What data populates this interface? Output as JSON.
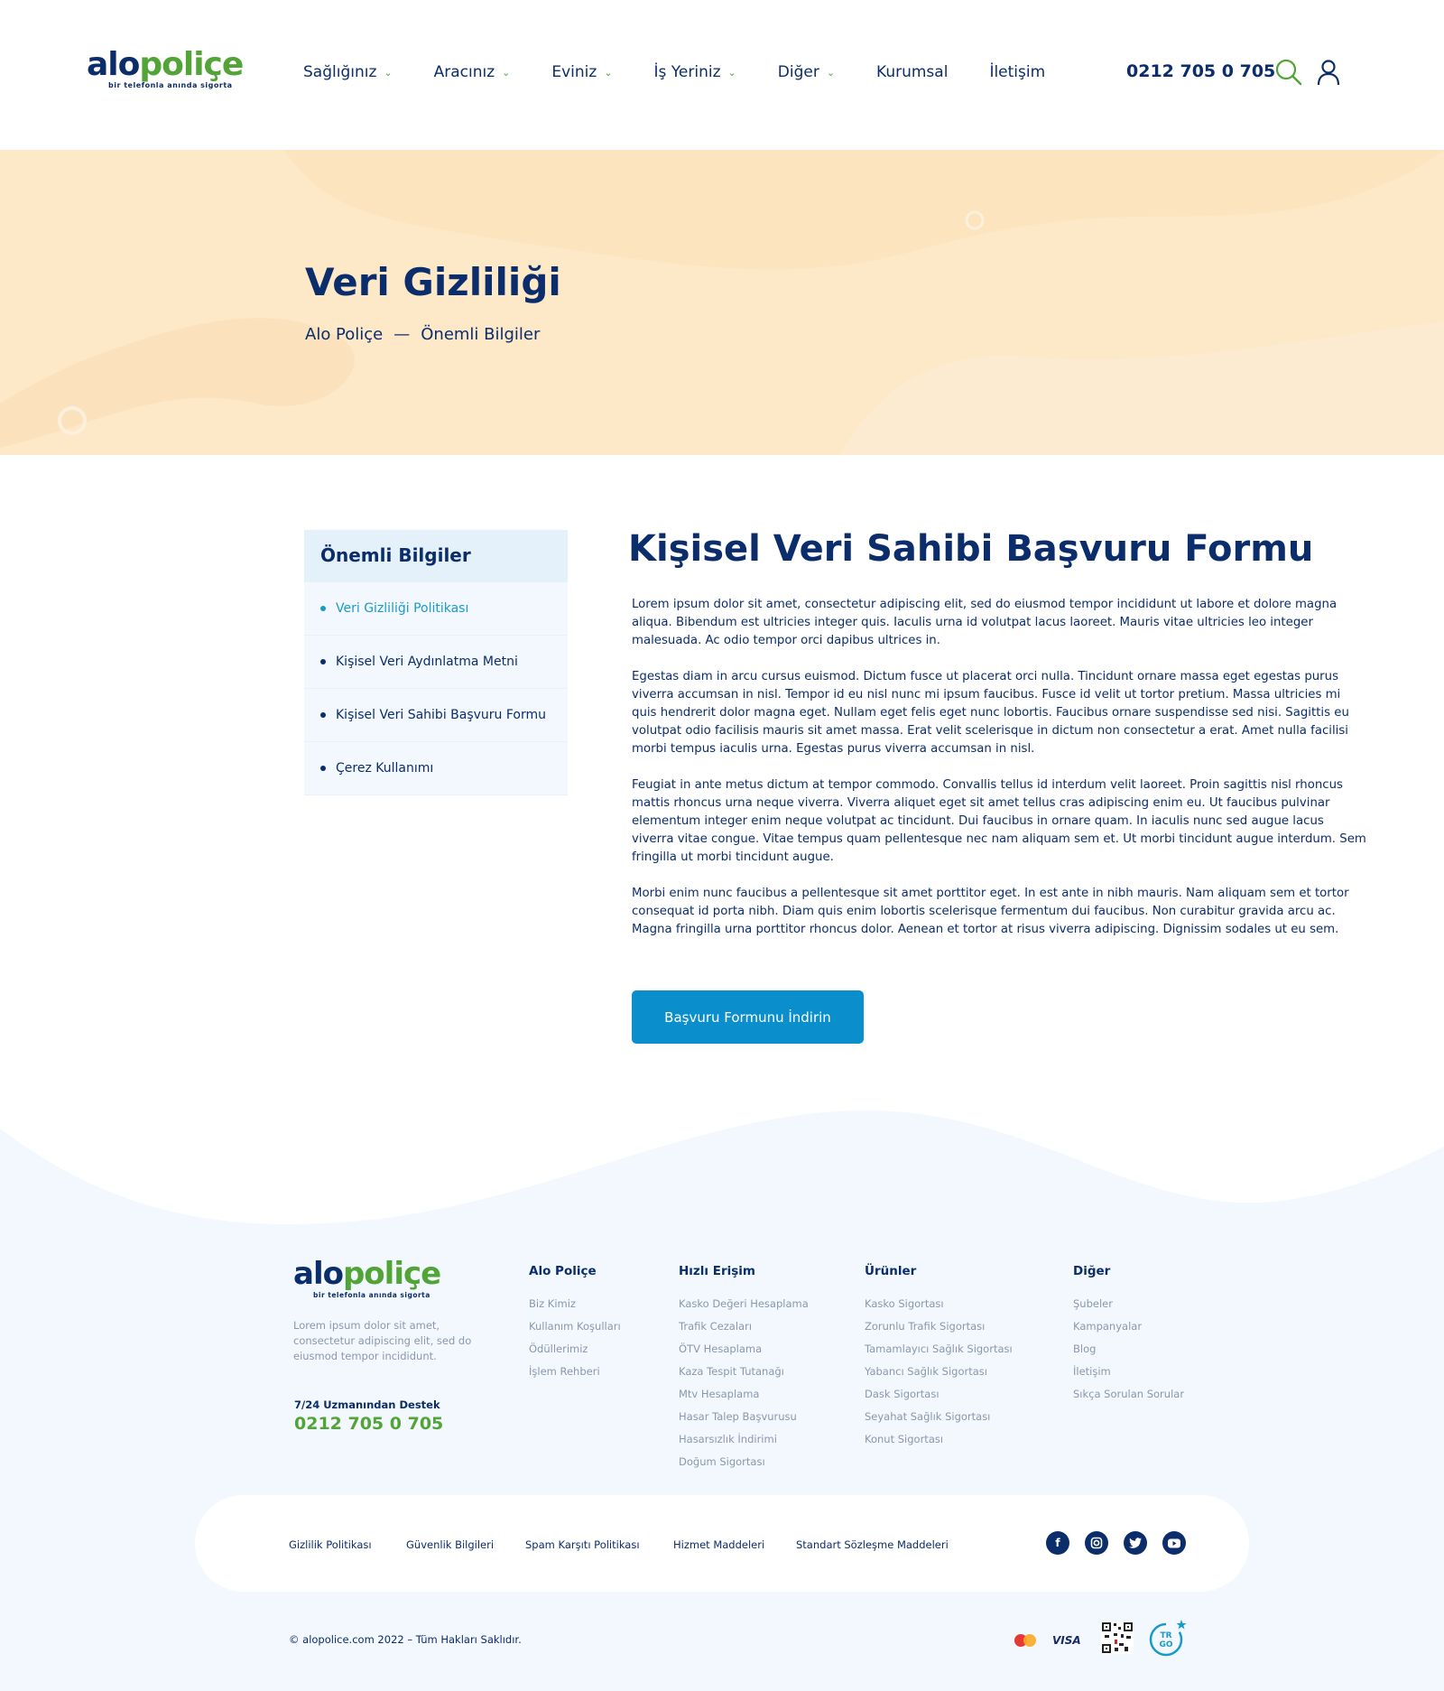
{
  "header": {
    "logo": {
      "alo": "alo",
      "police": "poliçe",
      "tagline": "bir telefonla anında sigorta"
    },
    "nav": [
      {
        "label": "Sağlığınız",
        "dropdown": true
      },
      {
        "label": "Aracınız",
        "dropdown": true
      },
      {
        "label": "Eviniz",
        "dropdown": true
      },
      {
        "label": "İş Yeriniz",
        "dropdown": true
      },
      {
        "label": "Diğer",
        "dropdown": true
      },
      {
        "label": "Kurumsal",
        "dropdown": false
      },
      {
        "label": "İletişim",
        "dropdown": false
      }
    ],
    "phone": "0212 705 0 705",
    "icons": [
      "search-icon",
      "user-icon"
    ]
  },
  "hero": {
    "title": "Veri Gizliliği",
    "breadcrumb": {
      "home": "Alo Poliçe",
      "separator": "—",
      "current": "Önemli Bilgiler"
    }
  },
  "sidebar": {
    "title": "Önemli Bilgiler",
    "items": [
      {
        "label": "Veri Gizliliği Politikası",
        "active": true
      },
      {
        "label": "Kişisel Veri Aydınlatma Metni",
        "active": false
      },
      {
        "label": "Kişisel Veri Sahibi Başvuru Formu",
        "active": false
      },
      {
        "label": "Çerez Kullanımı",
        "active": false
      }
    ]
  },
  "main": {
    "title": "Kişisel Veri Sahibi Başvuru Formu",
    "paragraphs": [
      " Lorem ipsum dolor sit amet, consectetur adipiscing elit, sed do eiusmod tempor incididunt ut labore et dolore magna aliqua. Bibendum est ultricies integer quis. Iaculis urna id volutpat lacus laoreet. Mauris vitae ultricies leo integer malesuada. Ac odio tempor orci dapibus ultrices in.",
      "Egestas diam in arcu cursus euismod. Dictum fusce ut placerat orci nulla. Tincidunt ornare massa eget egestas purus viverra accumsan in nisl. Tempor id eu nisl nunc mi ipsum faucibus. Fusce id velit ut tortor pretium. Massa ultricies mi quis hendrerit dolor magna eget. Nullam eget felis eget nunc lobortis. Faucibus ornare suspendisse sed nisi. Sagittis eu volutpat odio facilisis mauris sit amet massa. Erat velit scelerisque in dictum non consectetur a erat. Amet nulla facilisi morbi tempus iaculis urna. Egestas purus viverra accumsan in nisl.",
      "Feugiat in ante metus dictum at tempor commodo. Convallis tellus id interdum velit laoreet. Proin sagittis nisl rhoncus mattis rhoncus urna neque viverra. Viverra aliquet eget sit amet tellus cras adipiscing enim eu. Ut faucibus pulvinar elementum integer enim neque volutpat ac tincidunt. Dui faucibus in ornare quam. In iaculis nunc sed augue lacus viverra vitae congue. Vitae tempus quam pellentesque nec nam aliquam sem et. Ut morbi tincidunt augue interdum. Sem fringilla ut morbi tincidunt augue.",
      "Morbi enim nunc faucibus a pellentesque sit amet porttitor eget. In est ante in nibh mauris. Nam aliquam sem et tortor consequat id porta nibh. Diam quis enim lobortis scelerisque fermentum dui faucibus. Non curabitur gravida arcu ac. Magna fringilla urna porttitor rhoncus dolor. Aenean et tortor at risus viverra adipiscing. Dignissim sodales ut eu sem."
    ],
    "button_label": "Başvuru Formunu İndirin"
  },
  "footer": {
    "logo": {
      "alo": "alo",
      "police": "poliçe",
      "tagline": "bir telefonla anında sigorta"
    },
    "description": "Lorem ipsum dolor sit amet, consectetur adipiscing elit, sed do eiusmod tempor incididunt.",
    "support_label": "7/24 Uzmanından Destek",
    "support_phone": "0212 705 0 705",
    "columns": [
      {
        "title": "Alo Poliçe",
        "links": [
          "Biz Kimiz",
          "Kullanım Koşulları",
          "Ödüllerimiz",
          "İşlem Rehberi"
        ]
      },
      {
        "title": "Hızlı Erişim",
        "links": [
          "Kasko Değeri Hesaplama",
          "Trafik Cezaları",
          "ÖTV Hesaplama",
          "Kaza Tespit Tutanağı",
          "Mtv Hesaplama",
          "Hasar Talep Başvurusu",
          "Hasarsızlık İndirimi",
          "Doğum Sigortası"
        ]
      },
      {
        "title": "Ürünler",
        "links": [
          "Kasko Sigortası",
          "Zorunlu Trafik Sigortası",
          "Tamamlayıcı Sağlık Sigortası",
          "Yabancı Sağlık Sigortası",
          "Dask Sigortası",
          "Seyahat Sağlık Sigortası",
          "Konut Sigortası"
        ]
      },
      {
        "title": "Diğer",
        "links": [
          "Şubeler",
          "Kampanyalar",
          "Blog",
          "İletişim",
          "Sıkça Sorulan Sorular"
        ]
      }
    ],
    "legal_links": [
      "Gizlilik Politikası",
      "Güvenlik Bilgileri",
      "Spam Karşıtı Politikası",
      "Hizmet Maddeleri",
      "Standart Sözleşme Maddeleri"
    ],
    "social": [
      "facebook-icon",
      "instagram-icon",
      "twitter-icon",
      "youtube-icon"
    ],
    "copyright": "© alopolice.com 2022 – Tüm Hakları Saklıdır.",
    "payment": {
      "visa": "VISA",
      "trgo": "TR GO"
    }
  },
  "colors": {
    "navy": "#0b2d6b",
    "green": "#52a437",
    "blue": "#0a8fcc",
    "hero_bg": "#fde8c8",
    "footer_bg": "#f2f8fd"
  }
}
